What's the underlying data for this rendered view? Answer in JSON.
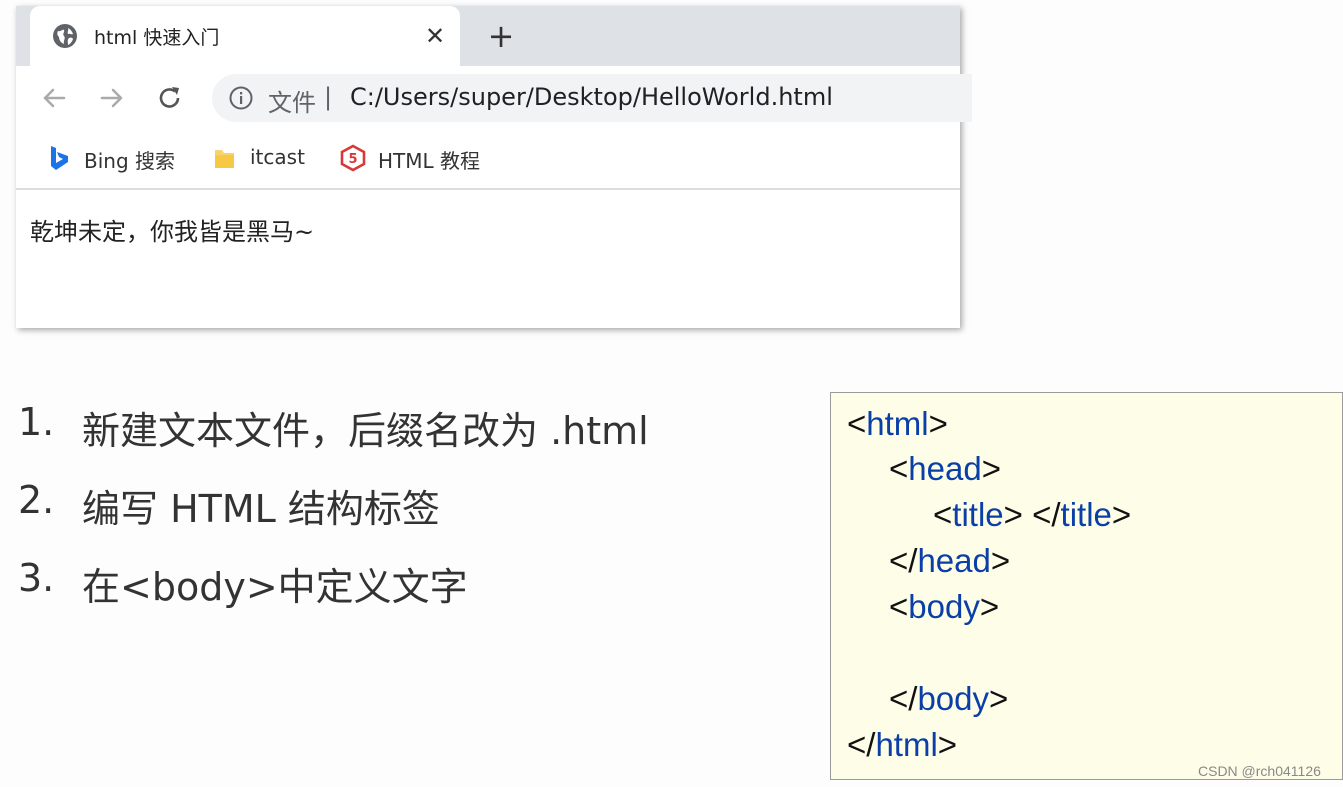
{
  "browser": {
    "tab": {
      "title": "html 快速入门",
      "close": "✕"
    },
    "new_tab": "+",
    "address_bar": {
      "scheme_label": "文件",
      "separator": "|",
      "url": "C:/Users/super/Desktop/HelloWorld.html"
    },
    "bookmarks": [
      {
        "label": "Bing 搜索",
        "icon": "bing-icon"
      },
      {
        "label": "itcast",
        "icon": "folder-icon"
      },
      {
        "label": "HTML 教程",
        "icon": "html5-icon"
      }
    ],
    "page_text": "乾坤未定，你我皆是黑马~"
  },
  "steps": [
    {
      "num": "1.",
      "text": "新建文本文件，后缀名改为 .html"
    },
    {
      "num": "2.",
      "text": "编写 HTML 结构标签"
    },
    {
      "num": "3.",
      "text": "在<body>中定义文字"
    }
  ],
  "code": {
    "l1": {
      "open": "<",
      "tag": "html",
      "close": ">"
    },
    "l2": {
      "open": "<",
      "tag": "head",
      "close": ">"
    },
    "l3": {
      "open1": "<",
      "tag1": "title",
      "close1": "> ",
      "open2": "</",
      "tag2": "title",
      "close2": ">"
    },
    "l4": {
      "open": "</",
      "tag": "head",
      "close": ">"
    },
    "l5": {
      "open": "<",
      "tag": "body",
      "close": ">"
    },
    "l6": {
      "open": "</",
      "tag": "body",
      "close": ">"
    },
    "l7": {
      "open": "</",
      "tag": "html",
      "close": ">"
    }
  },
  "watermark": "CSDN @rch041126",
  "colors": {
    "tag_blue": "#0a3fa8",
    "code_bg": "#fefee8",
    "tab_strip": "#dee1e6"
  }
}
